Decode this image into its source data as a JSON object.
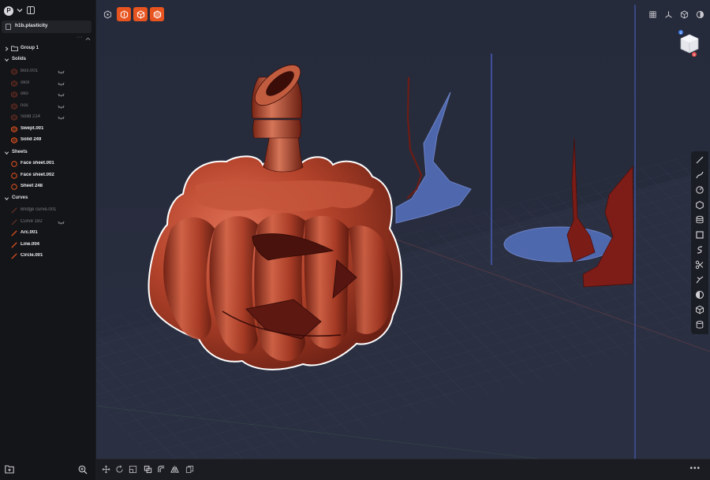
{
  "app": {
    "avatar_initial": "P",
    "file_name": "h1b.plasticity"
  },
  "tree": {
    "group": {
      "label": "Group 1"
    },
    "sections": {
      "solids": "Solids",
      "sheets": "Sheets",
      "curves": "Curves"
    },
    "solids": [
      {
        "label": "Box.001",
        "dim": true,
        "hidden": true
      },
      {
        "label": "okol",
        "dim": true,
        "hidden": true
      },
      {
        "label": "oko",
        "dim": true,
        "hidden": true
      },
      {
        "label": "nos",
        "dim": true,
        "hidden": true
      },
      {
        "label": "Solid 214",
        "dim": true,
        "hidden": true
      },
      {
        "label": "Swept.001",
        "dim": false,
        "hidden": false
      },
      {
        "label": "Solid 249",
        "dim": false,
        "hidden": false
      }
    ],
    "sheets": [
      {
        "label": "Face sheet.001",
        "dim": false
      },
      {
        "label": "Face sheet.002",
        "dim": false
      },
      {
        "label": "Sheet 248",
        "dim": false
      }
    ],
    "curves": [
      {
        "label": "Bridge curve.001",
        "dim": true
      },
      {
        "label": "Curve 182",
        "dim": true,
        "hidden": true
      },
      {
        "label": "Arc.001",
        "dim": false
      },
      {
        "label": "Line.004",
        "dim": false
      },
      {
        "label": "Circle.001",
        "dim": false
      }
    ]
  },
  "viewport": {
    "selection_modes": [
      "control-point-icon",
      "edge-mode-icon",
      "face-mode-icon",
      "solid-mode-icon"
    ],
    "view_options": [
      "grid-icon",
      "axes-icon",
      "xray-icon",
      "render-mode-icon"
    ],
    "nav_cube_axes": {
      "top": "Z",
      "x": "X"
    },
    "accent": "#e8541f",
    "sheet_color": "#5f7fd6",
    "model_color": "#b9432a"
  },
  "tools": [
    "line-tool-icon",
    "curve-tool-icon",
    "circle-tool-icon",
    "polygon-tool-icon",
    "layers-tool-icon",
    "rectangle-tool-icon",
    "spiral-tool-icon",
    "cut-tool-icon",
    "fillet-tool-icon",
    "boolean-tool-icon",
    "box-tool-icon",
    "cylinder-tool-icon"
  ],
  "bottombar": {
    "tools": [
      "move-icon",
      "rotate-icon",
      "scale-icon",
      "duplicate-icon",
      "offset-icon",
      "mirror-icon",
      "copy-icon"
    ],
    "more_label": "•••"
  }
}
